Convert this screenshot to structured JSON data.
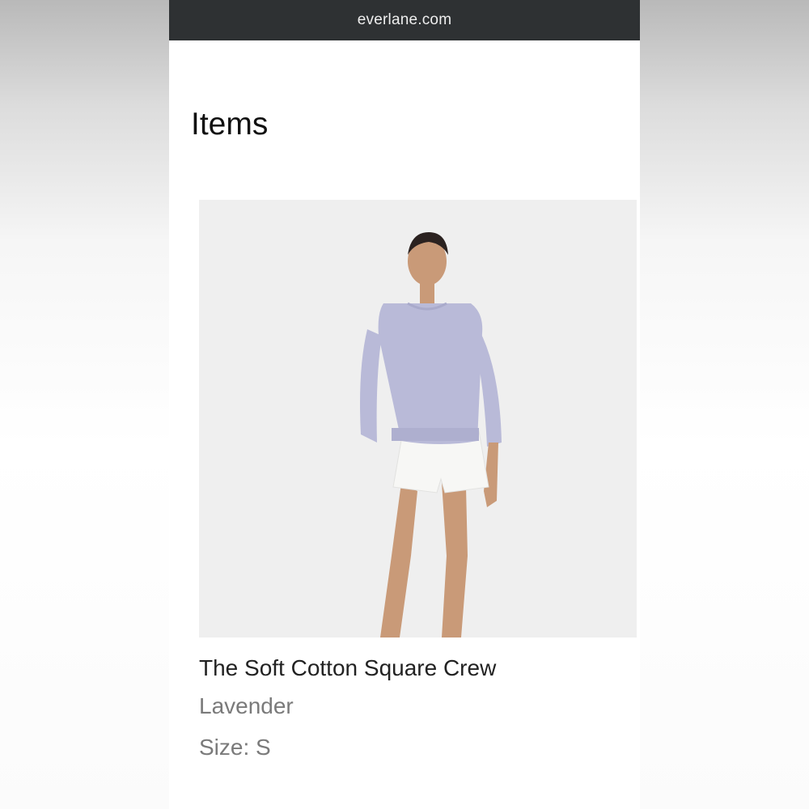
{
  "browser": {
    "url": "everlane.com"
  },
  "page": {
    "title": "Items"
  },
  "item": {
    "name": "The Soft Cotton Square Crew",
    "color": "Lavender",
    "size": "Size: S"
  },
  "colors": {
    "url_bar": "#2e3133",
    "image_bg": "#efefef",
    "sweater": "#b9bad8",
    "shorts": "#f7f7f5",
    "skin": "#c99a78"
  }
}
